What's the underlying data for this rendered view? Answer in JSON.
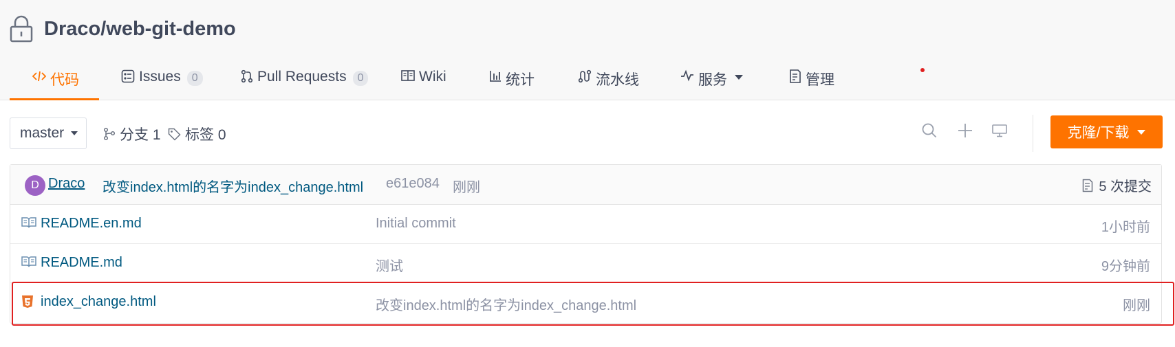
{
  "repo": {
    "name": "Draco/web-git-demo"
  },
  "tabs": [
    {
      "label": "代码",
      "icon": "code-icon"
    },
    {
      "label": "Issues",
      "count": "0",
      "icon": "issues-icon"
    },
    {
      "label": "Pull Requests",
      "count": "0",
      "icon": "pull-request-icon"
    },
    {
      "label": "Wiki",
      "icon": "wiki-book-icon"
    },
    {
      "label": "统计",
      "icon": "bar-chart-icon"
    },
    {
      "label": "流水线",
      "icon": "pipeline-icon"
    },
    {
      "label": "服务",
      "icon": "pulse-icon"
    },
    {
      "label": "管理",
      "icon": "settings-doc-icon"
    }
  ],
  "toolbar": {
    "branch": "master",
    "branches_label": "分支 1",
    "tags_label": "标签 0",
    "clone_label": "克隆/下载"
  },
  "commit": {
    "avatar_letter": "D",
    "author": "Draco",
    "message": "改变index.html的名字为index_change.html",
    "sha": "e61e084",
    "time": "刚刚",
    "count_label": "5 次提交"
  },
  "files": [
    {
      "name": "README.en.md",
      "message": "Initial commit",
      "time": "1小时前",
      "icon": "readme-book-icon"
    },
    {
      "name": "README.md",
      "message": "测试",
      "time": "9分钟前",
      "icon": "readme-book-icon"
    },
    {
      "name": "index_change.html",
      "message": "改变index.html的名字为index_change.html",
      "time": "刚刚",
      "icon": "html5-icon"
    }
  ],
  "colors": {
    "accent": "#fe7300",
    "link": "#005980",
    "muted": "#8c92a4",
    "highlight": "#e02020"
  }
}
